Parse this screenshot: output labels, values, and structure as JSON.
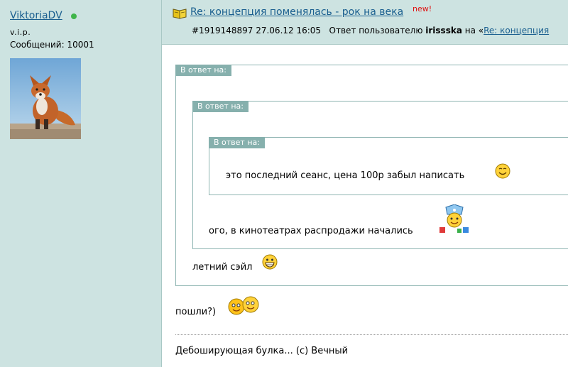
{
  "author": {
    "username": "ViktoriaDV",
    "status": "v.i.p.",
    "posts_label": "Сообщений: 10001"
  },
  "post": {
    "thread_title": "Re: концепция поменялась - рок на века",
    "new_badge": "new!",
    "id_date": "#1919148897 27.06.12 16:05",
    "reply_prefix": "Ответ пользователю",
    "reply_user": "irissska",
    "reply_on": "на «",
    "reply_link": "Re: концепция",
    "quotes": [
      {
        "label": "В ответ на:",
        "text": "летний сэйл"
      },
      {
        "label": "В ответ на:",
        "text": "ого, в кинотеатрах распродажи начались"
      },
      {
        "label": "В ответ на:",
        "text": "это последний сеанс, цена 100р забыл написать"
      }
    ],
    "reply_text": "пошли?)",
    "signature": "Дебоширующая булка... (с) Вечный"
  },
  "colors": {
    "sidebar_bg": "#cde3e1",
    "link": "#1a5f8f",
    "quote_label_bg": "#86b0ad",
    "new_badge": "#e01010"
  }
}
